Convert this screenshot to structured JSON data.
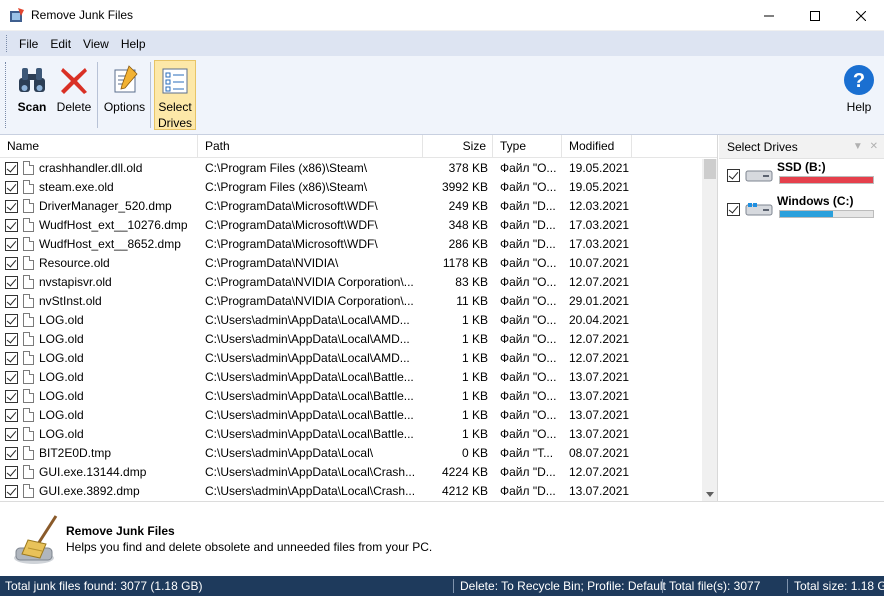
{
  "window": {
    "title": "Remove Junk Files"
  },
  "menu": [
    "File",
    "Edit",
    "View",
    "Help"
  ],
  "toolbar": {
    "scan": "Scan",
    "delete": "Delete",
    "options": "Options",
    "select_drives_1": "Select",
    "select_drives_2": "Drives",
    "help": "Help"
  },
  "columns": {
    "name": "Name",
    "path": "Path",
    "size": "Size",
    "type": "Type",
    "modified": "Modified"
  },
  "rows": [
    {
      "name": "crashhandler.dll.old",
      "path": "C:\\Program Files (x86)\\Steam\\",
      "size": "378 KB",
      "type": "Файл \"O...",
      "modified": "19.05.2021"
    },
    {
      "name": "steam.exe.old",
      "path": "C:\\Program Files (x86)\\Steam\\",
      "size": "3992 KB",
      "type": "Файл \"O...",
      "modified": "19.05.2021"
    },
    {
      "name": "DriverManager_520.dmp",
      "path": "C:\\ProgramData\\Microsoft\\WDF\\",
      "size": "249 KB",
      "type": "Файл \"D...",
      "modified": "12.03.2021"
    },
    {
      "name": "WudfHost_ext__10276.dmp",
      "path": "C:\\ProgramData\\Microsoft\\WDF\\",
      "size": "348 KB",
      "type": "Файл \"D...",
      "modified": "17.03.2021"
    },
    {
      "name": "WudfHost_ext__8652.dmp",
      "path": "C:\\ProgramData\\Microsoft\\WDF\\",
      "size": "286 KB",
      "type": "Файл \"D...",
      "modified": "17.03.2021"
    },
    {
      "name": "Resource.old",
      "path": "C:\\ProgramData\\NVIDIA\\",
      "size": "1178 KB",
      "type": "Файл \"O...",
      "modified": "10.07.2021"
    },
    {
      "name": "nvstapisvr.old",
      "path": "C:\\ProgramData\\NVIDIA Corporation\\...",
      "size": "83 KB",
      "type": "Файл \"O...",
      "modified": "12.07.2021"
    },
    {
      "name": "nvStInst.old",
      "path": "C:\\ProgramData\\NVIDIA Corporation\\...",
      "size": "11 KB",
      "type": "Файл \"O...",
      "modified": "29.01.2021"
    },
    {
      "name": "LOG.old",
      "path": "C:\\Users\\admin\\AppData\\Local\\AMD...",
      "size": "1 KB",
      "type": "Файл \"O...",
      "modified": "20.04.2021"
    },
    {
      "name": "LOG.old",
      "path": "C:\\Users\\admin\\AppData\\Local\\AMD...",
      "size": "1 KB",
      "type": "Файл \"O...",
      "modified": "12.07.2021"
    },
    {
      "name": "LOG.old",
      "path": "C:\\Users\\admin\\AppData\\Local\\AMD...",
      "size": "1 KB",
      "type": "Файл \"O...",
      "modified": "12.07.2021"
    },
    {
      "name": "LOG.old",
      "path": "C:\\Users\\admin\\AppData\\Local\\Battle...",
      "size": "1 KB",
      "type": "Файл \"O...",
      "modified": "13.07.2021"
    },
    {
      "name": "LOG.old",
      "path": "C:\\Users\\admin\\AppData\\Local\\Battle...",
      "size": "1 KB",
      "type": "Файл \"O...",
      "modified": "13.07.2021"
    },
    {
      "name": "LOG.old",
      "path": "C:\\Users\\admin\\AppData\\Local\\Battle...",
      "size": "1 KB",
      "type": "Файл \"O...",
      "modified": "13.07.2021"
    },
    {
      "name": "LOG.old",
      "path": "C:\\Users\\admin\\AppData\\Local\\Battle...",
      "size": "1 KB",
      "type": "Файл \"O...",
      "modified": "13.07.2021"
    },
    {
      "name": "BIT2E0D.tmp",
      "path": "C:\\Users\\admin\\AppData\\Local\\",
      "size": "0 KB",
      "type": "Файл \"T...",
      "modified": "08.07.2021"
    },
    {
      "name": "GUI.exe.13144.dmp",
      "path": "C:\\Users\\admin\\AppData\\Local\\Crash...",
      "size": "4224 KB",
      "type": "Файл \"D...",
      "modified": "12.07.2021"
    },
    {
      "name": "GUI.exe.3892.dmp",
      "path": "C:\\Users\\admin\\AppData\\Local\\Crash...",
      "size": "4212 KB",
      "type": "Файл \"D...",
      "modified": "13.07.2021"
    }
  ],
  "drives_panel": {
    "title": "Select Drives",
    "drives": [
      {
        "label": "SSD (B:)",
        "fill_fraction": 1.0,
        "color": "#e5404c"
      },
      {
        "label": "Windows (C:)",
        "fill_fraction": 0.57,
        "color": "#2aa0dc"
      }
    ]
  },
  "info": {
    "title": "Remove Junk Files",
    "description": "Helps you find and delete obsolete and unneeded files from your PC."
  },
  "status": {
    "total_junk": "Total junk files found: 3077 (1.18 GB)",
    "mode": "Delete: To Recycle Bin; Profile: Default",
    "total_files": "Total file(s): 3077",
    "total_size": "Total size: 1.18 GB"
  }
}
